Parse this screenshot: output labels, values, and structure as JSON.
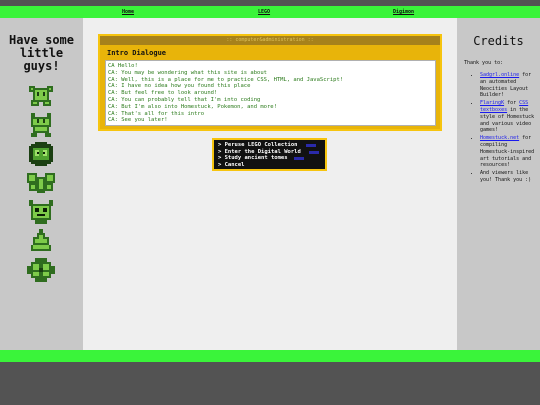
{
  "nav": {
    "home": "Home",
    "lego": "LEGO",
    "digimon": "Digimon"
  },
  "left": {
    "title_line1": "Have some",
    "title_line2": "little",
    "title_line3": "guys!"
  },
  "dialog": {
    "titlebar": ":: computer&administration ::",
    "heading": "Intro Dialogue",
    "lines": [
      "CA Hello!",
      "CA: You may be wondering what this site is about",
      "CA: Well, this is a place for me to practice CSS, HTML, and JavaScript!",
      "CA: I have no idea how you found this place",
      "CA: But feel free to look around!",
      "CA: You can probably tell that I'm into coding",
      "CA: But I'm also into Homestuck, Pokemon, and more!",
      "CA: That's all for this intro",
      "CA: See you later!"
    ]
  },
  "menu": {
    "items": [
      "> Peruse LEGO Collection",
      "> Enter the Digital World",
      "> Study ancient tomes",
      "> Cancel"
    ]
  },
  "credits": {
    "title": "Credits",
    "thanks": "Thank you to:",
    "item1_link": "Sadgrl.online",
    "item1_text": "for an automated Neocities Layout Builder!",
    "item2_link": "FlaringK",
    "item2_mid": "for",
    "item2_link2": "CSS textboxes",
    "item2_text": "in the style of Homestuck and various video games!",
    "item3_link": "Homestuck.net",
    "item3_text": "for compiling Homestuck-inspired art tutorials and resources!",
    "item4_text": "And viewers like you! Thank you :)"
  },
  "colors": {
    "green_bar": "#3af43a",
    "side_gray": "#c8c8c8",
    "dialog_gold": "#e8b40a",
    "dialog_text": "#2a7a1a",
    "link_blue": "#1a1aee"
  }
}
